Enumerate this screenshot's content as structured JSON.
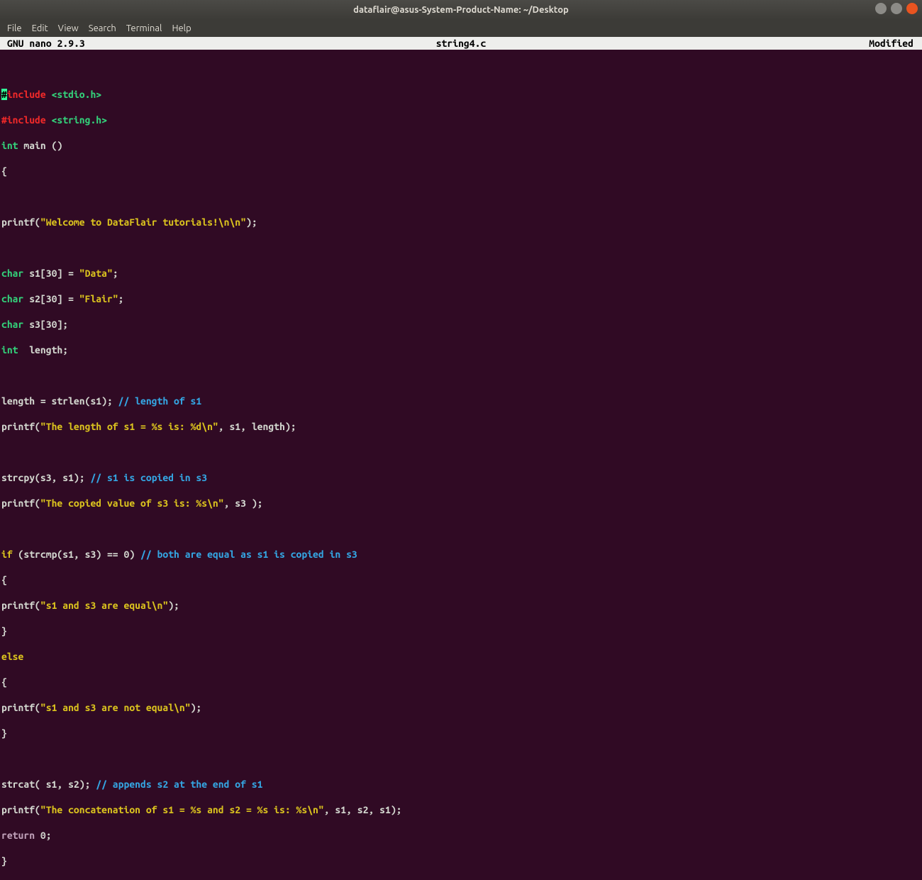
{
  "titlebar": {
    "title": "dataflair@asus-System-Product-Name: ~/Desktop"
  },
  "menubar": {
    "file": "File",
    "edit": "Edit",
    "view": "View",
    "search": "Search",
    "terminal": "Terminal",
    "help": "Help"
  },
  "nano": {
    "version": "GNU nano 2.9.3",
    "filename": "string4.c",
    "status": "Modified"
  },
  "code": {
    "l1a": "#",
    "l1b": "include",
    "l1c": " <stdio.h>",
    "l2a": "#include",
    "l2b": " <string.h>",
    "l3a": "int",
    "l3b": " main ()",
    "l4": "{",
    "l6a": "printf(",
    "l6b": "\"Welcome to DataFlair tutorials!\\n\\n\"",
    "l6c": ");",
    "l8a": "char",
    "l8b": " s1[30] = ",
    "l8c": "\"Data\"",
    "l8d": ";",
    "l9a": "char",
    "l9b": " s2[30] = ",
    "l9c": "\"Flair\"",
    "l9d": ";",
    "l10a": "char",
    "l10b": " s3[30];",
    "l11a": "int",
    "l11b": "  length;",
    "l13a": "length = strlen(s1); ",
    "l13b": "// length of s1",
    "l14a": "printf(",
    "l14b": "\"The length of s1 = %s is: %d\\n\"",
    "l14c": ", s1, length);",
    "l16a": "strcpy(s3, s1); ",
    "l16b": "// s1 is copied in s3",
    "l17a": "printf(",
    "l17b": "\"The copied value of s3 is: %s\\n\"",
    "l17c": ", s3 );",
    "l19a": "if",
    "l19b": " (strcmp(s1, s3) == 0) ",
    "l19c": "// both are equal as s1 is copied in s3",
    "l20": "{",
    "l21a": "printf(",
    "l21b": "\"s1 and s3 are equal\\n\"",
    "l21c": ");",
    "l22": "}",
    "l23a": "else",
    "l24": "{",
    "l25a": "printf(",
    "l25b": "\"s1 and s3 are not equal\\n\"",
    "l25c": ");",
    "l26": "}",
    "l28a": "strcat( s1, s2); ",
    "l28b": "// appends s2 at the end of s1",
    "l29a": "printf(",
    "l29b": "\"The concatenation of s1 = %s and s2 = %s is: %s\\n\"",
    "l29c": ", s1, s2, s1);",
    "l30a": "return",
    "l30b": " 0;",
    "l31": "}"
  }
}
